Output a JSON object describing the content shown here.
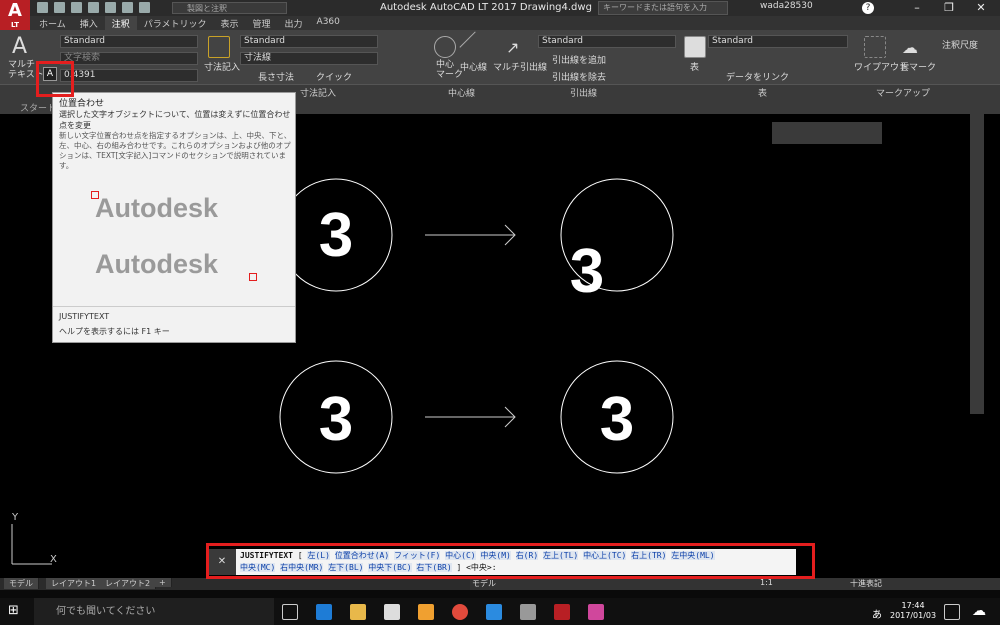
{
  "title_bar": {
    "window_title": "Autodesk AutoCAD LT 2017   Drawing4.dwg",
    "search_placeholder": "キーワードまたは語句を入力",
    "user": "wada28530",
    "workspace": "製図と注釈"
  },
  "app_logo": {
    "letter": "A",
    "sub": "LT"
  },
  "ribbon_tabs": [
    "ホーム",
    "挿入",
    "注釈",
    "パラメトリック",
    "表示",
    "管理",
    "出力",
    "A360"
  ],
  "ribbon": {
    "multiline_text": "マルチ\nテキスト",
    "text_style": "Standard",
    "text_search": "文字検索",
    "text_height": "0.4391",
    "dim_label": "寸法記入",
    "dim_style": "Standard",
    "dim_type": "寸法線",
    "dim_length": "長さ寸法",
    "dim_quick": "クイック",
    "center_mark": "中心\nマーク",
    "center_line": "中心線",
    "multileader": "マルチ引出線",
    "leader_style": "Standard",
    "leader_add": "引出線を追加",
    "leader_remove": "引出線を除去",
    "table": "表",
    "table_style": "Standard",
    "data_link": "データをリンク",
    "wipeout": "ワイプアウト",
    "cloud": "雲マーク",
    "scale": "注釈尺度"
  },
  "panels": {
    "dim": "寸法記入",
    "center": "中心線",
    "leader": "引出線",
    "table": "表",
    "markup": "マークアップ"
  },
  "file_tab": "スタート",
  "tooltip": {
    "title": "位置合わせ",
    "description": "選択した文字オブジェクトについて、位置は変えずに位置合わせ点を変更",
    "long_description": "新しい文字位置合わせ点を指定するオプションは、上、中央、下と、左、中心、右の組み合わせです。これらのオプションおよび他のオプションは、TEXT[文字記入]コマンドのセクションで説明されています。",
    "sample_word_1": "Autodesk",
    "sample_word_2": "Autodesk",
    "command": "JUSTIFYTEXT",
    "help": "ヘルプを表示するには F1 キー"
  },
  "drawing": {
    "number": "3"
  },
  "command_line": {
    "command": "JUSTIFYTEXT",
    "options_line1": [
      "左(L)",
      "位置合わせ(A)",
      "フィット(F)",
      "中心(C)",
      "中央(M)",
      "右(R)",
      "左上(TL)",
      "中心上(TC)",
      "右上(TR)",
      "左中央(ML)"
    ],
    "options_line2": [
      "中央(MC)",
      "右中央(MR)",
      "左下(BL)",
      "中央下(BC)",
      "右下(BR)"
    ],
    "default": "<中央>:"
  },
  "layout_tabs": [
    "モデル",
    "レイアウト1",
    "レイアウト2",
    "+"
  ],
  "status": {
    "model": "モデル",
    "scale": "1:1",
    "units": "十進表記"
  },
  "taskbar": {
    "search": "何でも聞いてください",
    "time": "17:44",
    "date": "2017/01/03",
    "ime": "あ"
  },
  "colors": {
    "highlight": "#e41e1e",
    "ribbon": "#434343",
    "canvas": "#000000",
    "autocad_red": "#b81f24"
  }
}
